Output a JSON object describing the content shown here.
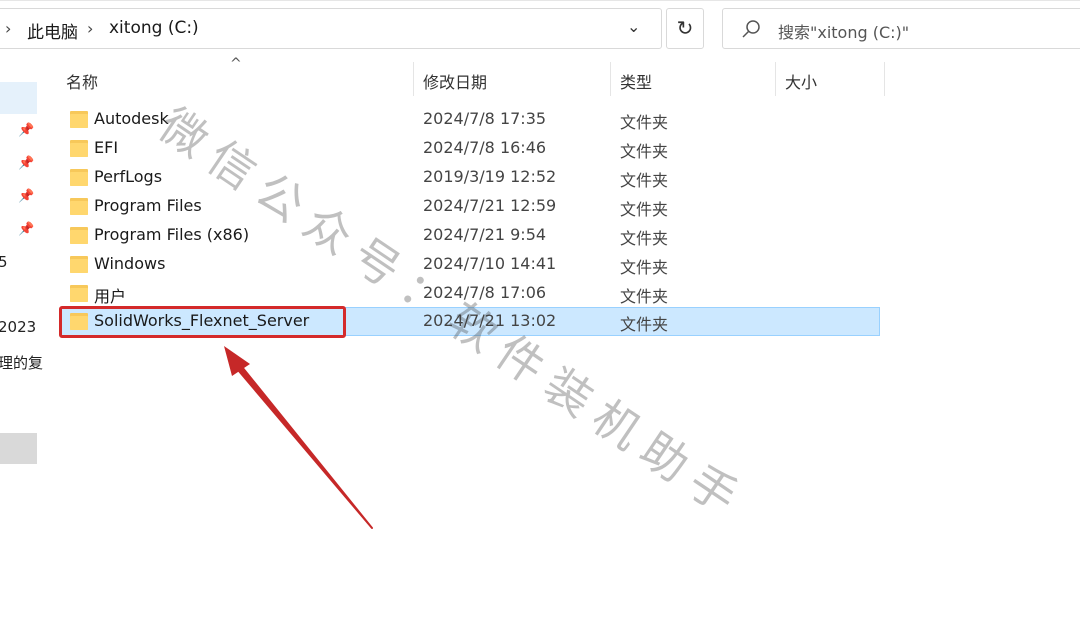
{
  "address_bar": {
    "crumbs": [
      "此电脑",
      "xitong (C:)"
    ],
    "refresh_icon": "refresh-icon",
    "dropdown_icon": "chevron-down-icon"
  },
  "search": {
    "placeholder": "搜索\"xitong (C:)\"",
    "icon": "search-icon"
  },
  "nav": {
    "fragments": [
      "5",
      "2023",
      "理的复"
    ]
  },
  "columns": {
    "name": "名称",
    "date": "修改日期",
    "type": "类型",
    "size": "大小"
  },
  "files": [
    {
      "name": "Autodesk",
      "date": "2024/7/8 17:35",
      "type": "文件夹"
    },
    {
      "name": "EFI",
      "date": "2024/7/8 16:46",
      "type": "文件夹"
    },
    {
      "name": "PerfLogs",
      "date": "2019/3/19 12:52",
      "type": "文件夹"
    },
    {
      "name": "Program Files",
      "date": "2024/7/21 12:59",
      "type": "文件夹"
    },
    {
      "name": "Program Files (x86)",
      "date": "2024/7/21 9:54",
      "type": "文件夹"
    },
    {
      "name": "Windows",
      "date": "2024/7/10 14:41",
      "type": "文件夹"
    },
    {
      "name": "用户",
      "date": "2024/7/8 17:06",
      "type": "文件夹"
    },
    {
      "name": "SolidWorks_Flexnet_Server",
      "date": "2024/7/21 13:02",
      "type": "文件夹"
    }
  ],
  "watermark": "微信公众号：软件装机助手",
  "colors": {
    "selection": "#cce8ff",
    "highlight_box": "#d42a2a",
    "folder": "#ffd76e"
  }
}
